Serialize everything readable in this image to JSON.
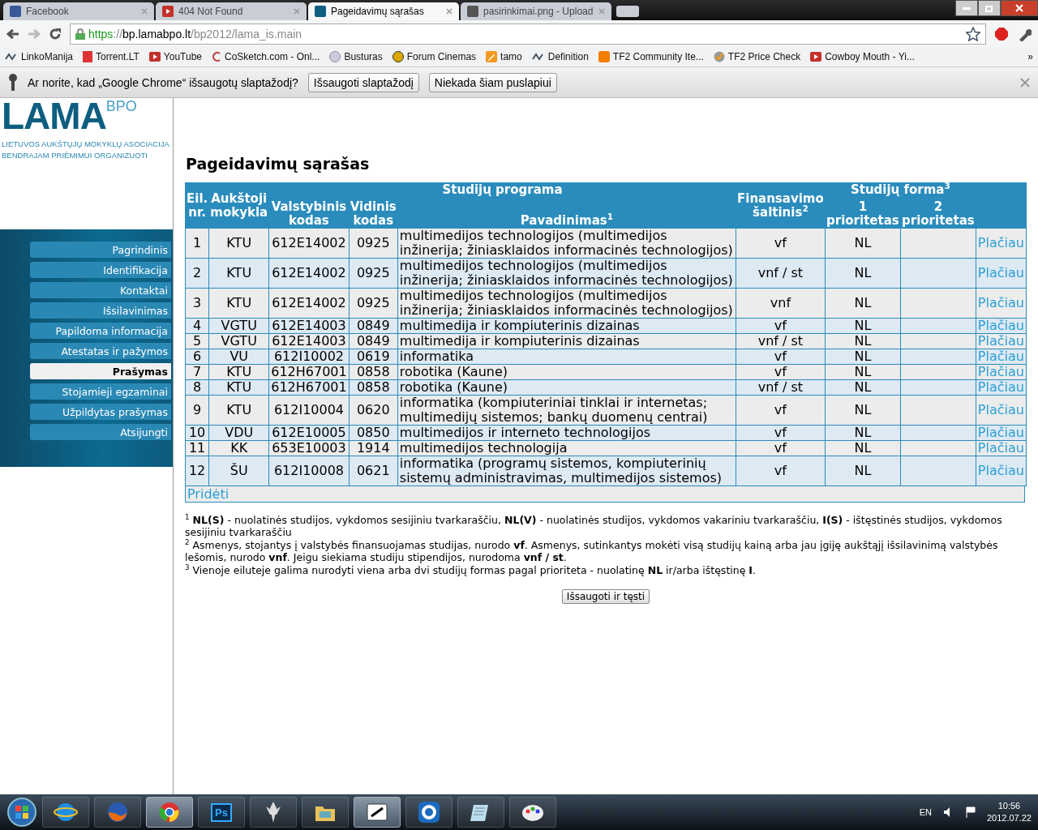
{
  "browser": {
    "tabs": [
      {
        "title": "Facebook",
        "selected": false
      },
      {
        "title": "404 Not Found",
        "selected": false
      },
      {
        "title": "Pageidavimų sąrašas",
        "selected": true
      },
      {
        "title": "pasirinkimai.png - Upload",
        "selected": false
      }
    ],
    "url": {
      "scheme": "https",
      "sep": "://",
      "host": "bp.lamabpo.lt",
      "path": "/bp2012/lama_is.main"
    },
    "bookmarks": [
      "LinkoManija",
      "Torrent.LT",
      "YouTube",
      "CoSketch.com - Onl...",
      "Busturas",
      "Forum Cinemas",
      "tamo",
      "Definition",
      "TF2 Community Ite...",
      "TF2 Price Check",
      "Cowboy Mouth - Yi..."
    ],
    "more": "»"
  },
  "infobar": {
    "message": "Ar norite, kad „Google Chrome“ išsaugotų slaptažodį?",
    "buttons": [
      "Išsaugoti slaptažodį",
      "Niekada šiam puslapiui"
    ]
  },
  "logo": {
    "name": "LAMA",
    "suffix": "BPO",
    "lines": [
      "LIETUVOS AUKŠTŲJŲ MOKYKLŲ ASOCIACIJA",
      "BENDRAJAM PRIĖMIMUI ORGANIZUOTI"
    ]
  },
  "nav": [
    {
      "label": "Pagrindinis",
      "selected": false
    },
    {
      "label": "Identifikacija",
      "selected": false
    },
    {
      "label": "Kontaktai",
      "selected": false
    },
    {
      "label": "Išsilavinimas",
      "selected": false
    },
    {
      "label": "Papildoma informacija",
      "selected": false
    },
    {
      "label": "Atestatas ir pažymos",
      "selected": false
    },
    {
      "label": "Prašymas",
      "selected": true
    },
    {
      "label": "Stojamieji egzaminai",
      "selected": false
    },
    {
      "label": "Užpildytas prašymas",
      "selected": false
    },
    {
      "label": "Atsijungti",
      "selected": false
    }
  ],
  "title": "Pageidavimų sąrašas",
  "table": {
    "header": {
      "nr": "Eil. nr.",
      "school": "Aukštoji mokykla",
      "program": "Studijų programa",
      "state_code": "Valstybinis kodas",
      "internal_code": "Vidinis kodas",
      "name": "Pavadinimas$^{1}$",
      "funding": "Finansavimo šaltinis$^{2}$",
      "form": "Studijų forma$^{3}$",
      "priority_1": "1 prioritetas",
      "priority_2": "2 prioritetas"
    },
    "rows": [
      {
        "nr": "1",
        "school": "KTU",
        "state_code": "612E14002",
        "internal_code": "0925",
        "name": "multimedijos technologijos (multimedijos inžinerija; žiniasklaidos informacinės technologijos)",
        "funding": "vf",
        "priority_1": "NL",
        "link": "Plačiau"
      },
      {
        "nr": "2",
        "school": "KTU",
        "state_code": "612E14002",
        "internal_code": "0925",
        "name": "multimedijos technologijos (multimedijos inžinerija; žiniasklaidos informacinės technologijos)",
        "funding": "vnf / st",
        "priority_1": "NL",
        "link": "Plačiau"
      },
      {
        "nr": "3",
        "school": "KTU",
        "state_code": "612E14002",
        "internal_code": "0925",
        "name": "multimedijos technologijos (multimedijos inžinerija; žiniasklaidos informacinės technologijos)",
        "funding": "vnf",
        "priority_1": "NL",
        "link": "Plačiau"
      },
      {
        "nr": "4",
        "school": "VGTU",
        "state_code": "612E14003",
        "internal_code": "0849",
        "name": "multimedija ir kompiuterinis dizainas",
        "funding": "vf",
        "priority_1": "NL",
        "link": "Plačiau"
      },
      {
        "nr": "5",
        "school": "VGTU",
        "state_code": "612E14003",
        "internal_code": "0849",
        "name": "multimedija ir kompiuterinis dizainas",
        "funding": "vnf / st",
        "priority_1": "NL",
        "link": "Plačiau"
      },
      {
        "nr": "6",
        "school": "VU",
        "state_code": "612I10002",
        "internal_code": "0619",
        "name": "informatika",
        "funding": "vf",
        "priority_1": "NL",
        "link": "Plačiau"
      },
      {
        "nr": "7",
        "school": "KTU",
        "state_code": "612H67001",
        "internal_code": "0858",
        "name": "robotika (Kaune)",
        "funding": "vf",
        "priority_1": "NL",
        "link": "Plačiau"
      },
      {
        "nr": "8",
        "school": "KTU",
        "state_code": "612H67001",
        "internal_code": "0858",
        "name": "robotika (Kaune)",
        "funding": "vnf / st",
        "priority_1": "NL",
        "link": "Plačiau"
      },
      {
        "nr": "9",
        "school": "KTU",
        "state_code": "612I10004",
        "internal_code": "0620",
        "name": "informatika (kompiuteriniai tinklai ir internetas; multimedijų sistemos; bankų duomenų centrai)",
        "funding": "vf",
        "priority_1": "NL",
        "link": "Plačiau"
      },
      {
        "nr": "10",
        "school": "VDU",
        "state_code": "612E10005",
        "internal_code": "0850",
        "name": "multimedijos ir interneto technologijos",
        "funding": "vf",
        "priority_1": "NL",
        "link": "Plačiau"
      },
      {
        "nr": "11",
        "school": "KK",
        "state_code": "653E10003",
        "internal_code": "1914",
        "name": "multimedijos technologija",
        "funding": "vf",
        "priority_1": "NL",
        "link": "Plačiau"
      },
      {
        "nr": "12",
        "school": "ŠU",
        "state_code": "612I10008",
        "internal_code": "0621",
        "name": "informatika (programų sistemos, kompiuterinių sistemų administravimas, multimedijos sistemos)",
        "funding": "vf",
        "priority_1": "NL",
        "link": "Plačiau"
      }
    ],
    "add": "Pridėti"
  },
  "footnotes": [
    "$^{1}$ **NL(S)** - nuolatinės studijos, vykdomos sesijiniu tvarkaraščiu, **NL(V)** - nuolatinės studijos, vykdomos vakariniu tvarkaraščiu, **I(S)** - ištęstinės studijos, vykdomos sesijiniu tvarkaraščiu",
    "$^{2}$ Asmenys, stojantys į valstybės finansuojamas studijas, nurodo **vf**. Asmenys, sutinkantys mokėti visą studijų kainą arba jau įgiję aukštąjį išsilavinimą valstybės lešomis, nurodo **vnf**. Jeigu siekiama studiju stipendijos, nurodoma **vnf / st**.",
    "$^{3}$ Vienoje eiluteje galima nurodyti viena arba dvi studijų formas pagal prioriteta - nuolatinę **NL** ir/arba ištęstinę **I**."
  ],
  "save_button": "Išsaugoti ir tęsti",
  "taskbar": {
    "apps": [
      {
        "kind": "ie",
        "active": false
      },
      {
        "kind": "firefox",
        "active": false
      },
      {
        "kind": "chrome",
        "active": true
      },
      {
        "kind": "ps",
        "label": "Ps",
        "active": false
      },
      {
        "kind": "skyrim",
        "active": false
      },
      {
        "kind": "folder",
        "active": false
      },
      {
        "kind": "xchat",
        "active": true
      },
      {
        "kind": "ring",
        "active": false
      },
      {
        "kind": "notepad",
        "active": false
      },
      {
        "kind": "paint",
        "active": false
      }
    ],
    "language": "EN",
    "time": "10:56",
    "date": "2012.07.22"
  }
}
